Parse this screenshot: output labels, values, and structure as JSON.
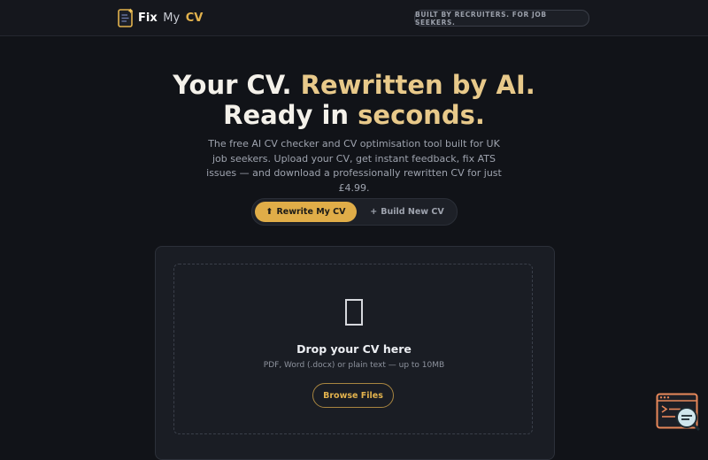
{
  "header": {
    "brand": {
      "fix": "Fix",
      "my": "My",
      "cv": "CV"
    },
    "tagline": "BUILT BY RECRUITERS. FOR JOB SEEKERS."
  },
  "hero": {
    "line1_white": "Your CV.",
    "line1_gold": "Rewritten by AI.",
    "line2_white": "Ready in ",
    "line2_gold": "seconds.",
    "subtitle": "The free AI CV checker and CV optimisation tool built for UK job seekers. Upload your CV, get instant feedback, fix ATS issues — and download a professionally rewritten CV for just £4.99."
  },
  "mode_toggle": {
    "rewrite": {
      "icon": "⬆",
      "label": "Rewrite My CV"
    },
    "build": {
      "icon": "+",
      "label": "Build New CV"
    },
    "selected": "Rewrite My CV"
  },
  "upload": {
    "title": "Drop your CV here",
    "hint": "PDF, Word (.docx) or plain text — up to 10MB",
    "browse_label": "Browse Files"
  },
  "colors": {
    "accent": "#e0ad48",
    "accent_text": "#e8c98a",
    "background": "#111318",
    "card": "#1a1d24",
    "widget": "#e8885a"
  },
  "icons": {
    "brand": "document-logo-icon",
    "drop": "file-icon",
    "widget": "chat-support-icon"
  }
}
